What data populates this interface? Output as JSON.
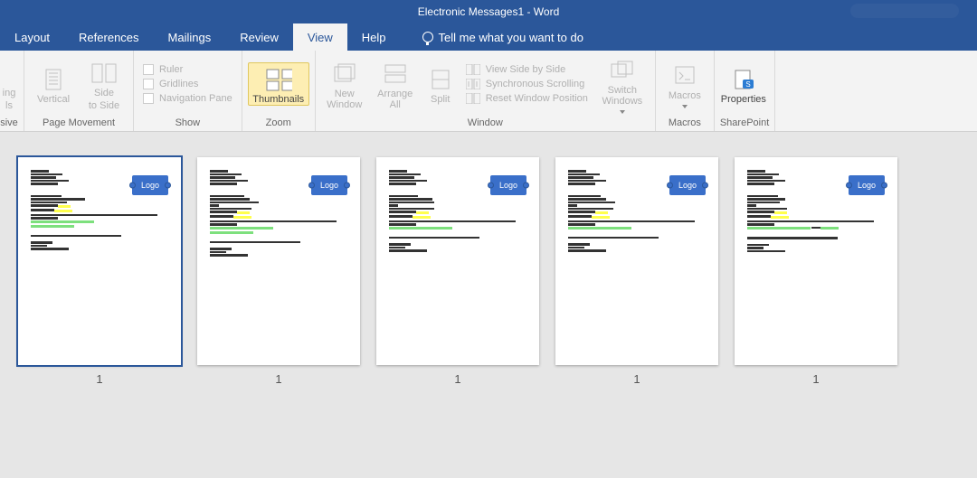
{
  "app": {
    "title": "Electronic Messages1  -  Word"
  },
  "tabs": {
    "layout": "Layout",
    "references": "References",
    "mailings": "Mailings",
    "review": "Review",
    "view": "View",
    "help": "Help",
    "tellme": "Tell me what you want to do"
  },
  "ribbon": {
    "page_movement": {
      "group": "Page Movement",
      "reading": "ing",
      "reading2": "ls",
      "vertical": "Vertical",
      "side": "Side",
      "to_side": "to Side",
      "immersive": "sive"
    },
    "show": {
      "group": "Show",
      "ruler": "Ruler",
      "gridlines": "Gridlines",
      "navpane": "Navigation Pane"
    },
    "zoom": {
      "group": "Zoom",
      "thumbnails": "Thumbnails"
    },
    "window": {
      "group": "Window",
      "new_window": "New Window",
      "arrange_all": "Arrange All",
      "split": "Split",
      "side_by_side": "View Side by Side",
      "sync_scroll": "Synchronous Scrolling",
      "reset_pos": "Reset Window Position",
      "switch": "Switch Windows"
    },
    "macros": {
      "group": "Macros",
      "macros": "Macros"
    },
    "sharepoint": {
      "group": "SharePoint",
      "properties": "Properties"
    }
  },
  "thumbs": {
    "logo": "Logo",
    "labels": [
      "1",
      "1",
      "1",
      "1",
      "1"
    ]
  }
}
